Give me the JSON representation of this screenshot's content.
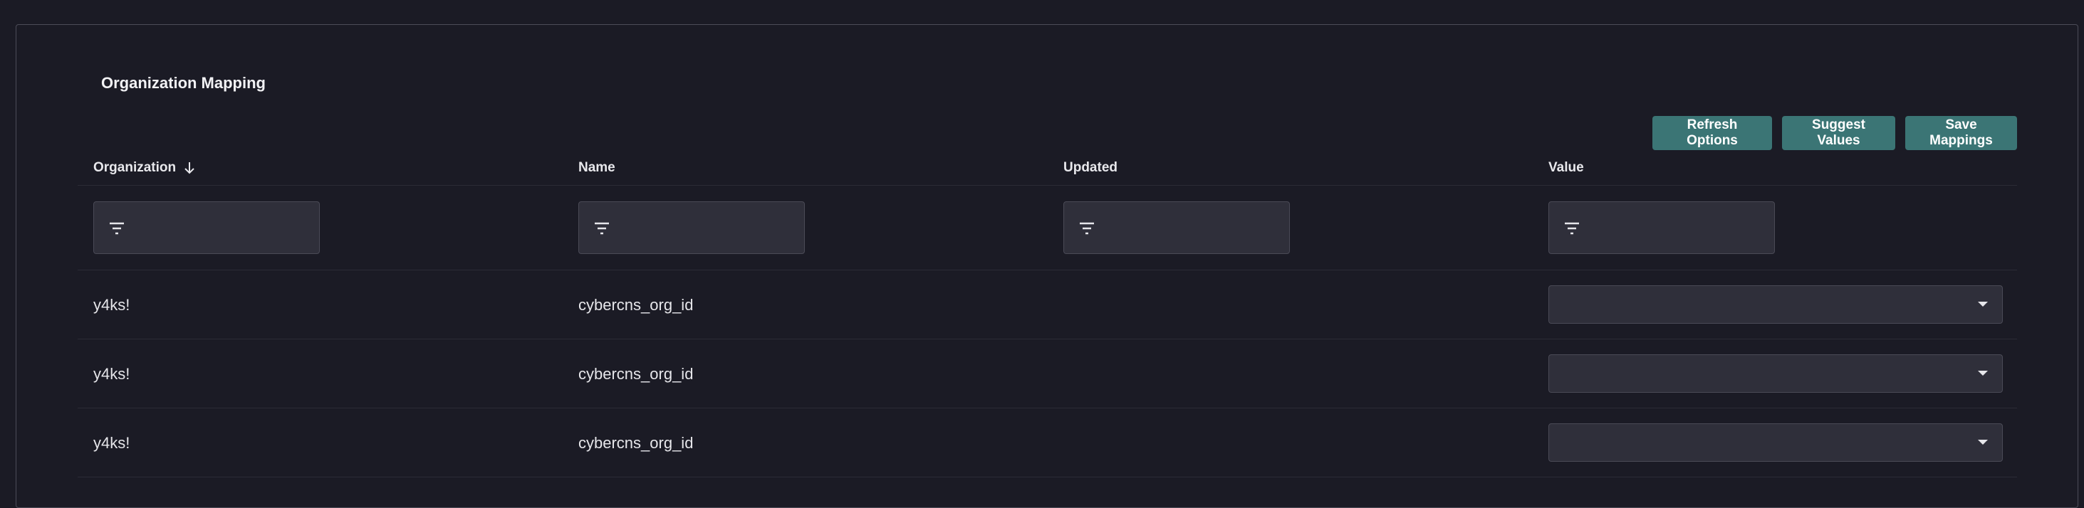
{
  "panel": {
    "title": "Organization Mapping"
  },
  "toolbar": {
    "refresh_label": "Refresh Options",
    "suggest_label": "Suggest Values",
    "save_label": "Save Mappings"
  },
  "table": {
    "columns": [
      {
        "label": "Organization",
        "sort": "descending",
        "sort_icon": "arrow-down-icon"
      },
      {
        "label": "Name"
      },
      {
        "label": "Updated"
      },
      {
        "label": "Value"
      }
    ],
    "filter_icon": "filter-icon",
    "rows": [
      {
        "organization": "y4ks!",
        "name": "cybercns_org_id",
        "updated": "",
        "value": ""
      },
      {
        "organization": "y4ks!",
        "name": "cybercns_org_id",
        "updated": "",
        "value": ""
      },
      {
        "organization": "y4ks!",
        "name": "cybercns_org_id",
        "updated": "",
        "value": ""
      }
    ]
  },
  "colors": {
    "background": "#1b1b25",
    "button": "#3b7575",
    "input": "#2f2f3a",
    "border": "#4a4a56"
  }
}
